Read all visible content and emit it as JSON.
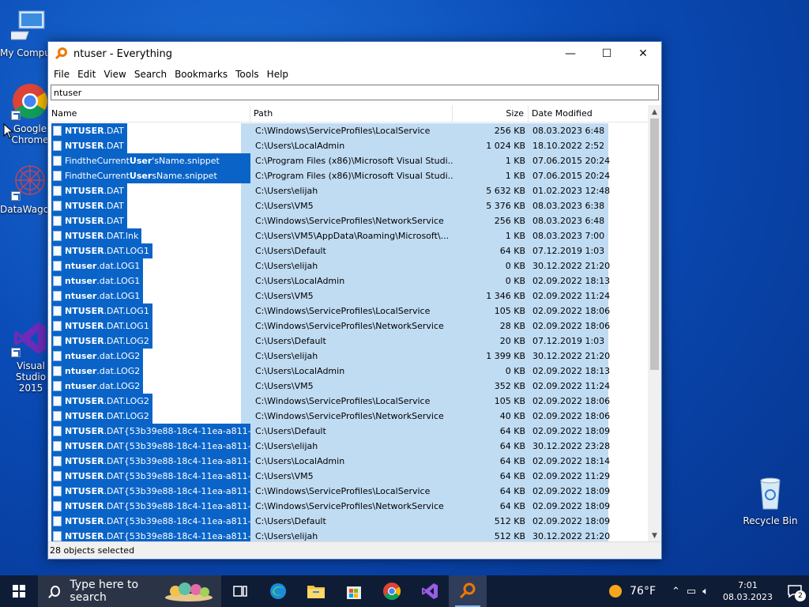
{
  "desktop": {
    "icons": [
      {
        "label": "My Computer"
      },
      {
        "label": "Google Chrome"
      },
      {
        "label": "DataWagon"
      },
      {
        "label": "Visual Studio 2015"
      },
      {
        "label": "Recycle Bin"
      }
    ]
  },
  "window": {
    "title": "ntuser - Everything",
    "controls": {
      "minimize": "—",
      "maximize": "☐",
      "close": "✕"
    },
    "menu": [
      "File",
      "Edit",
      "View",
      "Search",
      "Bookmarks",
      "Tools",
      "Help"
    ],
    "search_value": "ntuser",
    "columns": {
      "name": "Name",
      "path": "Path",
      "size": "Size",
      "date": "Date Modified"
    },
    "rows": [
      {
        "pre": "",
        "bold": "NTUSER",
        "post": ".DAT",
        "path": "C:\\Windows\\ServiceProfiles\\LocalService",
        "size": "256 KB",
        "date": "08.03.2023 6:48"
      },
      {
        "pre": "",
        "bold": "NTUSER",
        "post": ".DAT",
        "path": "C:\\Users\\LocalAdmin",
        "size": "1 024 KB",
        "date": "18.10.2022 2:52"
      },
      {
        "pre": "FindtheCurrent",
        "bold": "User",
        "post": "'sName.snippet",
        "path": "C:\\Program Files (x86)\\Microsoft Visual Studi...",
        "size": "1 KB",
        "date": "07.06.2015 20:24"
      },
      {
        "pre": "FindtheCurrent",
        "bold": "User",
        "post": "sName.snippet",
        "path": "C:\\Program Files (x86)\\Microsoft Visual Studi...",
        "size": "1 KB",
        "date": "07.06.2015 20:24"
      },
      {
        "pre": "",
        "bold": "NTUSER",
        "post": ".DAT",
        "path": "C:\\Users\\elijah",
        "size": "5 632 KB",
        "date": "01.02.2023 12:48"
      },
      {
        "pre": "",
        "bold": "NTUSER",
        "post": ".DAT",
        "path": "C:\\Users\\VM5",
        "size": "5 376 KB",
        "date": "08.03.2023 6:38"
      },
      {
        "pre": "",
        "bold": "NTUSER",
        "post": ".DAT",
        "path": "C:\\Windows\\ServiceProfiles\\NetworkService",
        "size": "256 KB",
        "date": "08.03.2023 6:48"
      },
      {
        "pre": "",
        "bold": "NTUSER",
        "post": ".DAT.lnk",
        "path": "C:\\Users\\VM5\\AppData\\Roaming\\Microsoft\\...",
        "size": "1 KB",
        "date": "08.03.2023 7:00"
      },
      {
        "pre": "",
        "bold": "NTUSER",
        "post": ".DAT.LOG1",
        "path": "C:\\Users\\Default",
        "size": "64 KB",
        "date": "07.12.2019 1:03"
      },
      {
        "pre": "",
        "bold": "ntuser",
        "post": ".dat.LOG1",
        "path": "C:\\Users\\elijah",
        "size": "0 KB",
        "date": "30.12.2022 21:20"
      },
      {
        "pre": "",
        "bold": "ntuser",
        "post": ".dat.LOG1",
        "path": "C:\\Users\\LocalAdmin",
        "size": "0 KB",
        "date": "02.09.2022 18:13"
      },
      {
        "pre": "",
        "bold": "ntuser",
        "post": ".dat.LOG1",
        "path": "C:\\Users\\VM5",
        "size": "1 346 KB",
        "date": "02.09.2022 11:24"
      },
      {
        "pre": "",
        "bold": "NTUSER",
        "post": ".DAT.LOG1",
        "path": "C:\\Windows\\ServiceProfiles\\LocalService",
        "size": "105 KB",
        "date": "02.09.2022 18:06"
      },
      {
        "pre": "",
        "bold": "NTUSER",
        "post": ".DAT.LOG1",
        "path": "C:\\Windows\\ServiceProfiles\\NetworkService",
        "size": "28 KB",
        "date": "02.09.2022 18:06"
      },
      {
        "pre": "",
        "bold": "NTUSER",
        "post": ".DAT.LOG2",
        "path": "C:\\Users\\Default",
        "size": "20 KB",
        "date": "07.12.2019 1:03"
      },
      {
        "pre": "",
        "bold": "ntuser",
        "post": ".dat.LOG2",
        "path": "C:\\Users\\elijah",
        "size": "1 399 KB",
        "date": "30.12.2022 21:20"
      },
      {
        "pre": "",
        "bold": "ntuser",
        "post": ".dat.LOG2",
        "path": "C:\\Users\\LocalAdmin",
        "size": "0 KB",
        "date": "02.09.2022 18:13"
      },
      {
        "pre": "",
        "bold": "ntuser",
        "post": ".dat.LOG2",
        "path": "C:\\Users\\VM5",
        "size": "352 KB",
        "date": "02.09.2022 11:24"
      },
      {
        "pre": "",
        "bold": "NTUSER",
        "post": ".DAT.LOG2",
        "path": "C:\\Windows\\ServiceProfiles\\LocalService",
        "size": "105 KB",
        "date": "02.09.2022 18:06"
      },
      {
        "pre": "",
        "bold": "NTUSER",
        "post": ".DAT.LOG2",
        "path": "C:\\Windows\\ServiceProfiles\\NetworkService",
        "size": "40 KB",
        "date": "02.09.2022 18:06"
      },
      {
        "pre": "",
        "bold": "NTUSER",
        "post": ".DAT{53b39e88-18c4-11ea-a811-0...",
        "path": "C:\\Users\\Default",
        "size": "64 KB",
        "date": "02.09.2022 18:09"
      },
      {
        "pre": "",
        "bold": "NTUSER",
        "post": ".DAT{53b39e88-18c4-11ea-a811-0...",
        "path": "C:\\Users\\elijah",
        "size": "64 KB",
        "date": "30.12.2022 23:28"
      },
      {
        "pre": "",
        "bold": "NTUSER",
        "post": ".DAT{53b39e88-18c4-11ea-a811-0...",
        "path": "C:\\Users\\LocalAdmin",
        "size": "64 KB",
        "date": "02.09.2022 18:14"
      },
      {
        "pre": "",
        "bold": "NTUSER",
        "post": ".DAT{53b39e88-18c4-11ea-a811-0...",
        "path": "C:\\Users\\VM5",
        "size": "64 KB",
        "date": "02.09.2022 11:29"
      },
      {
        "pre": "",
        "bold": "NTUSER",
        "post": ".DAT{53b39e88-18c4-11ea-a811-0...",
        "path": "C:\\Windows\\ServiceProfiles\\LocalService",
        "size": "64 KB",
        "date": "02.09.2022 18:09"
      },
      {
        "pre": "",
        "bold": "NTUSER",
        "post": ".DAT{53b39e88-18c4-11ea-a811-0...",
        "path": "C:\\Windows\\ServiceProfiles\\NetworkService",
        "size": "64 KB",
        "date": "02.09.2022 18:09"
      },
      {
        "pre": "",
        "bold": "NTUSER",
        "post": ".DAT{53b39e88-18c4-11ea-a811-0...",
        "path": "C:\\Users\\Default",
        "size": "512 KB",
        "date": "02.09.2022 18:09"
      },
      {
        "pre": "",
        "bold": "NTUSER",
        "post": ".DAT{53b39e88-18c4-11ea-a811-0...",
        "path": "C:\\Users\\elijah",
        "size": "512 KB",
        "date": "30.12.2022 21:20"
      }
    ],
    "status": "28 objects selected"
  },
  "taskbar": {
    "search_placeholder": "Type here to search",
    "apps": [
      "task-view",
      "edge",
      "file-explorer",
      "store",
      "chrome",
      "visual-studio",
      "everything"
    ],
    "weather": "76°F",
    "time": "7:01",
    "date": "08.03.2023",
    "notifications": "2"
  },
  "colors": {
    "selection": "#0a64c8",
    "row_highlight": "#c0dcf3",
    "accent": "#f07800"
  }
}
